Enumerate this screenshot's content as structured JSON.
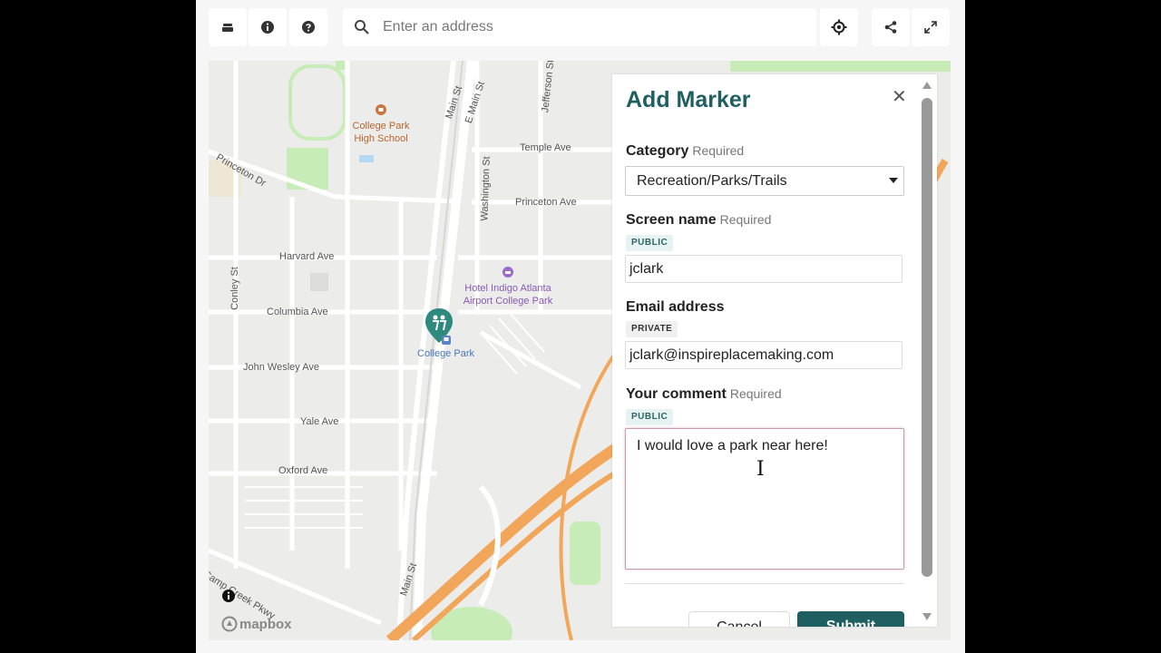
{
  "toolbar": {
    "layers_icon": "layers-icon",
    "info_icon": "info-icon",
    "help_icon": "help-icon",
    "search_placeholder": "Enter an address",
    "locate_icon": "crosshair-icon",
    "share_icon": "share-icon",
    "fullscreen_icon": "expand-icon"
  },
  "map": {
    "streets": [
      "Main St",
      "E Main St",
      "Jefferson St",
      "Temple Ave",
      "Princeton Dr",
      "Washington St",
      "Princeton Ave",
      "Harvard Ave",
      "Conley St",
      "Columbia Ave",
      "John Wesley Ave",
      "Yale Ave",
      "Oxford Ave",
      "Camp Creek Pkwy",
      "Main St"
    ],
    "pois": {
      "school_line1": "College Park",
      "school_line2": "High School",
      "hotel_line1": "Hotel Indigo Atlanta",
      "hotel_line2": "Airport College Park",
      "station": "College Park"
    },
    "attribution": "mapbox"
  },
  "panel": {
    "title": "Add Marker",
    "category_label": "Category",
    "category_required": "Required",
    "category_value": "Recreation/Parks/Trails",
    "screen_name_label": "Screen name",
    "screen_name_required": "Required",
    "screen_name_badge": "PUBLIC",
    "screen_name_value": "jclark",
    "email_label": "Email address",
    "email_badge": "PRIVATE",
    "email_value": "jclark@inspireplacemaking.com",
    "comment_label": "Your comment",
    "comment_required": "Required",
    "comment_badge": "PUBLIC",
    "comment_value": "I would love a park near here!",
    "cancel_label": "Cancel",
    "submit_label": "Submit"
  },
  "colors": {
    "brand": "#1f5f62",
    "highway": "#f2a65a",
    "park": "#c8ecb8"
  }
}
